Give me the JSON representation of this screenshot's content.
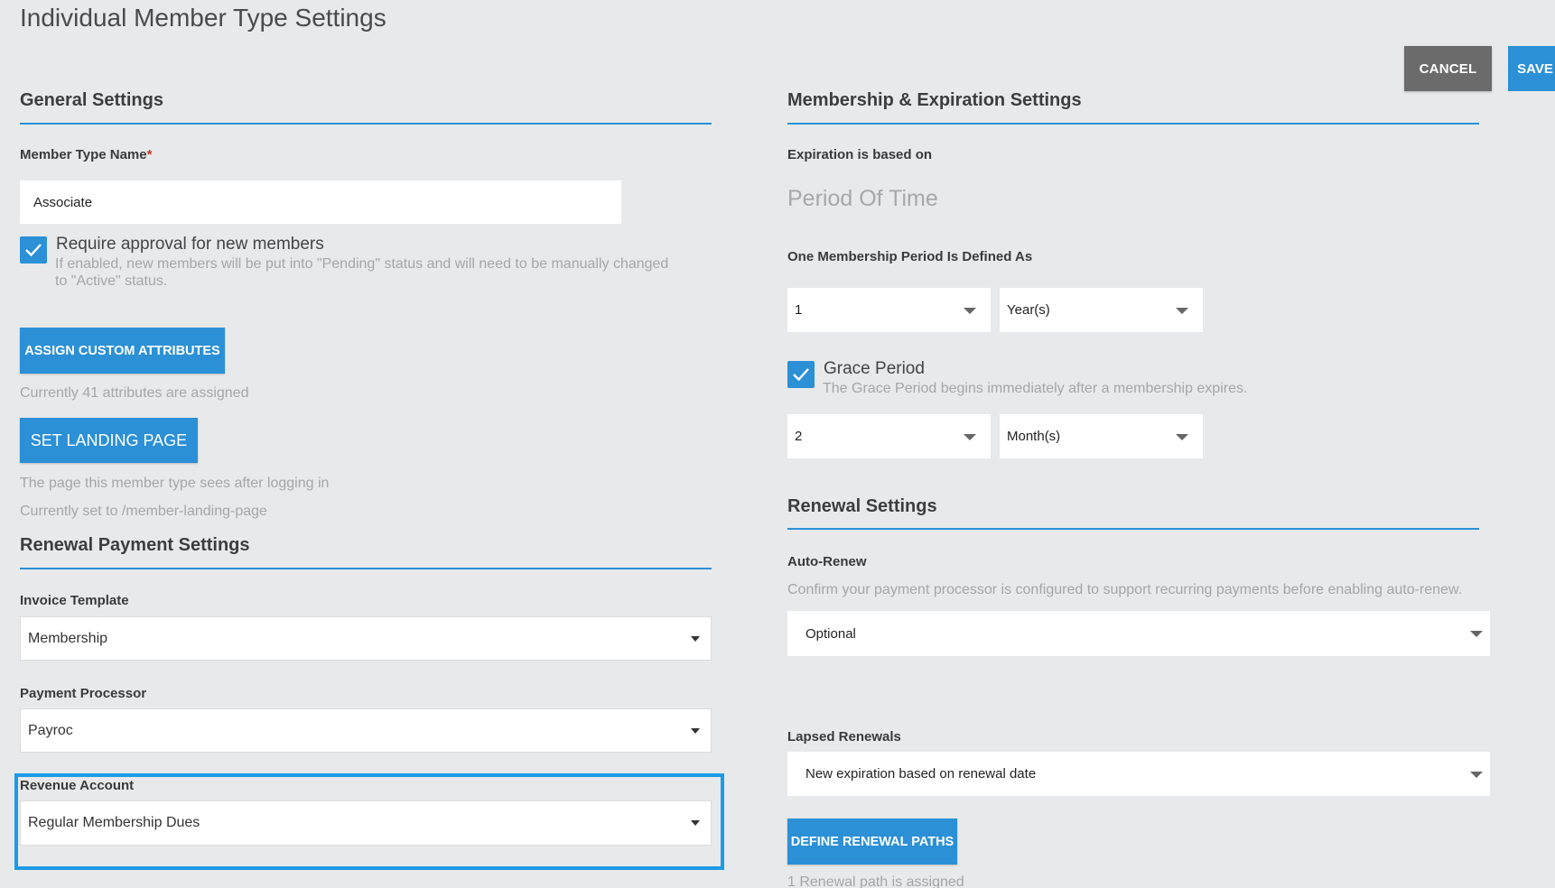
{
  "page": {
    "title": "Individual Member Type Settings",
    "cancel_label": "CANCEL",
    "save_label": "SAVE"
  },
  "general": {
    "title": "General Settings",
    "member_type_name_label": "Member Type Name",
    "required_marker": "*",
    "member_type_name_value": "Associate",
    "require_approval": {
      "checked": true,
      "label": "Require approval for new members",
      "hint_line1": "If enabled, new members will be put into \"Pending\" status and will need to be manually changed",
      "hint_line2": "to \"Active\" status."
    },
    "assign_attributes_label": "ASSIGN CUSTOM ATTRIBUTES",
    "attributes_status": "Currently 41 attributes are assigned",
    "set_landing_label": "SET LANDING PAGE",
    "landing_hint": "The page this member type sees after logging in",
    "landing_current": "Currently set to /member-landing-page"
  },
  "renewal_payment": {
    "title": "Renewal Payment Settings",
    "invoice_template_label": "Invoice Template",
    "invoice_template_value": "Membership",
    "payment_processor_label": "Payment Processor",
    "payment_processor_value": "Payroc",
    "revenue_account_label": "Revenue Account",
    "revenue_account_value": "Regular Membership Dues"
  },
  "membership_expiration": {
    "title": "Membership & Expiration Settings",
    "expiration_based_label": "Expiration is based on",
    "expiration_based_value": "Period Of Time",
    "period_defined_label": "One Membership Period Is Defined As",
    "period_count": "1",
    "period_unit": "Year(s)",
    "grace_period": {
      "checked": true,
      "label": "Grace Period",
      "hint": "The Grace Period begins immediately after a membership expires."
    },
    "grace_count": "2",
    "grace_unit": "Month(s)"
  },
  "renewal": {
    "title": "Renewal Settings",
    "auto_renew_label": "Auto-Renew",
    "auto_renew_hint": "Confirm your payment processor is configured to support recurring payments before enabling auto-renew.",
    "auto_renew_value": "Optional",
    "lapsed_label": "Lapsed Renewals",
    "lapsed_value": "New expiration based on renewal date",
    "define_paths_label": "DEFINE RENEWAL PATHS",
    "paths_status": "1 Renewal path is assigned"
  },
  "colors": {
    "accent": "#2b90d6",
    "highlight": "#1e9be8",
    "background": "#e8e9eb",
    "cancel": "#6b6b6b"
  }
}
